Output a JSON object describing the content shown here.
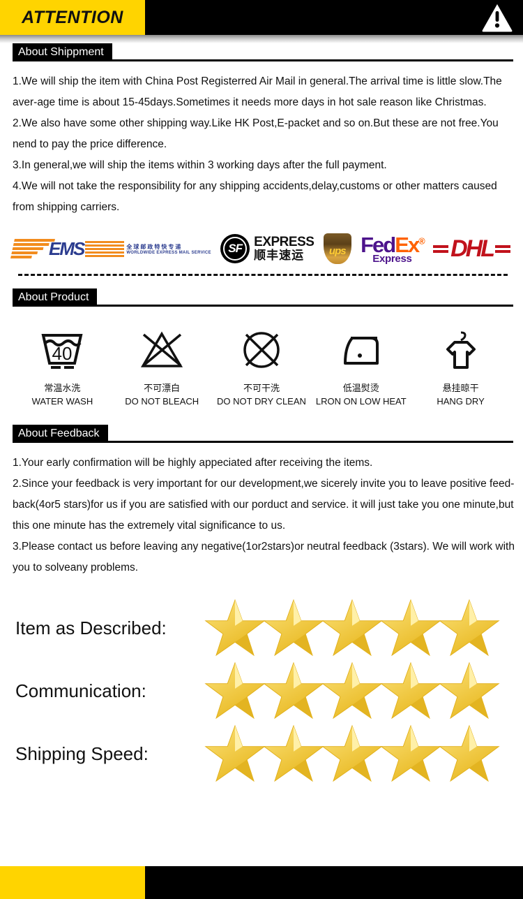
{
  "header": {
    "attention_label": "ATTENTION",
    "warning_icon": "warning-triangle-icon",
    "yellow": "#FFD400",
    "black": "#000000"
  },
  "sections": {
    "shipment": {
      "heading": "About Shippment",
      "lines": [
        "1.We will ship the item with China Post Registerred Air Mail in general.The arrival time is little slow.The aver-age time is about 15-45days.Sometimes it needs  more days in hot sale reason like Christmas.",
        "2.We also have some other shipping way.Like HK Post,E-packet and so on.But these are not free.You nend to pay the price difference.",
        "3.In general,we will ship the items within 3 working days after the full payment.",
        "4.We will not take the responsibility for any shipping accidents,delay,customs or other matters caused from shipping carriers."
      ]
    },
    "product": {
      "heading": "About Product"
    },
    "feedback": {
      "heading": "About Feedback",
      "lines": [
        "1.Your early confirmation will be highly appeciated after receiving the items.",
        "2.Since your feedback is very important for our development,we sicerely invite you to leave positive feed-back(4or5 stars)for us if you are satisfied with our porduct and service. it will just take you one minute,but this one minute has the extremely vital significance to us.",
        "3.Please contact us before leaving any negative(1or2stars)or neutral feedback (3stars). We will work with you to solveany problems."
      ]
    }
  },
  "carriers": [
    {
      "name": "EMS",
      "icon": "ems-logo",
      "word": "EMS",
      "cn": "全球邮政特快专递",
      "en": "WORLDWIDE EXPRESS MAIL SERVICE",
      "color": "#2B3C8F",
      "accent": "#F28C1E"
    },
    {
      "name": "SF Express",
      "icon": "sf-express-logo",
      "mark": "SF",
      "en": "EXPRESS",
      "cn": "顺丰速运",
      "color": "#000000"
    },
    {
      "name": "UPS",
      "icon": "ups-logo",
      "word": "ups",
      "color": "#FFCC33"
    },
    {
      "name": "FedEx",
      "icon": "fedex-logo",
      "fed": "Fed",
      "ex": "Ex",
      "reg": "®",
      "sub": "Express",
      "color_fed": "#4D148C",
      "color_ex": "#FF6200"
    },
    {
      "name": "DHL",
      "icon": "dhl-logo",
      "word": "DHL",
      "color": "#C1121C"
    }
  ],
  "care_symbols": [
    {
      "icon": "wash-tub-40-icon",
      "temperature": "40",
      "cn": "常温水洗",
      "en": "WATER WASH"
    },
    {
      "icon": "do-not-bleach-icon",
      "cn": "不可漂白",
      "en": "DO NOT BLEACH"
    },
    {
      "icon": "do-not-dry-clean-icon",
      "cn": "不可干洗",
      "en": "DO NOT DRY CLEAN"
    },
    {
      "icon": "iron-low-heat-icon",
      "cn": "低温熨烫",
      "en": "LRON ON LOW HEAT"
    },
    {
      "icon": "hang-dry-icon",
      "cn": "悬挂晾干",
      "en": "HANG DRY"
    }
  ],
  "ratings": [
    {
      "label": "Item as Described:",
      "stars": 5
    },
    {
      "label": "Communication:",
      "stars": 5
    },
    {
      "label": "Shipping Speed:",
      "stars": 5
    }
  ],
  "footer": {
    "yellow": "#FFD400",
    "black": "#000000"
  }
}
